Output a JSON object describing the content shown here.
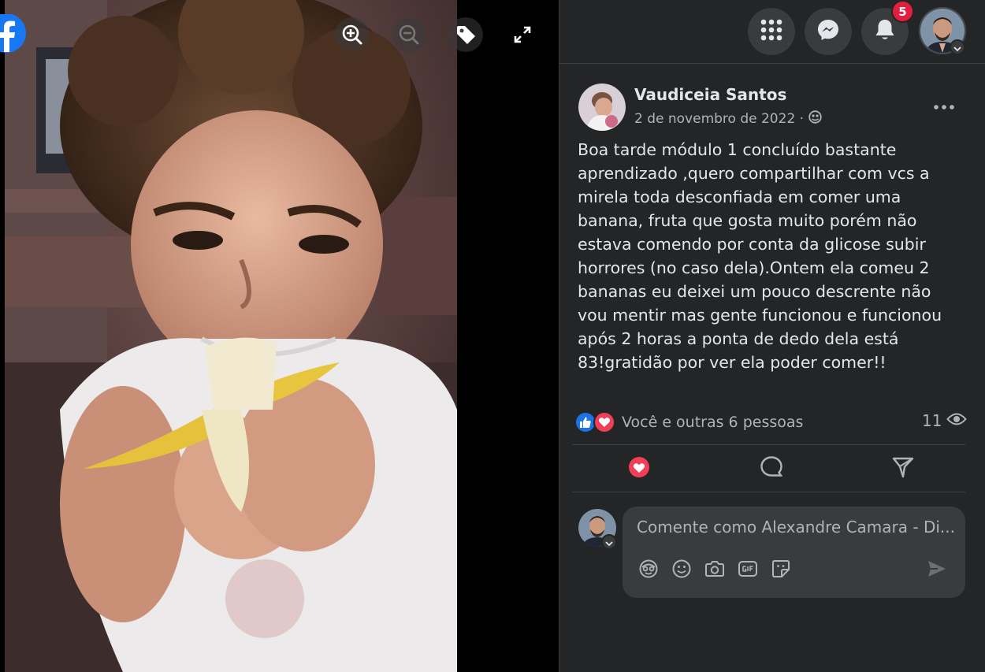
{
  "viewer": {
    "brand_icon": "facebook-logo-icon",
    "controls": [
      {
        "name": "zoom-in-icon"
      },
      {
        "name": "zoom-out-icon"
      },
      {
        "name": "tag-icon"
      },
      {
        "name": "fullscreen-icon"
      }
    ],
    "photo_subject": "photo"
  },
  "topbar": {
    "menu_icon": "grid-menu-icon",
    "messenger_icon": "messenger-icon",
    "notifications_icon": "bell-icon",
    "notifications_count": "5",
    "account_icon": "chevron-down-icon"
  },
  "post": {
    "author": "Vaudiceia Santos",
    "date": "2 de novembro de 2022 ·",
    "audience_icon": "globe-icon",
    "more_icon": "more-dots-icon",
    "text": "Boa tarde módulo 1 concluído bastante aprendizado ,quero compartilhar com vcs a mirela toda desconfiada em comer uma banana, fruta que gosta muito porém não estava comendo por conta da glicose subir horrores (no caso dela).Ontem ela comeu 2 bananas eu deixei um pouco descrente não vou mentir mas gente funcionou e funcionou após 2 horas a ponta de dedo dela está 83!gratidão por ver ela poder comer!!",
    "reactions_text": "Você e outras 6 pessoas",
    "views": "11",
    "actions": [
      {
        "name": "love-reaction-icon"
      },
      {
        "name": "comment-icon"
      },
      {
        "name": "share-icon"
      }
    ]
  },
  "comment": {
    "placeholder": "Comente como Alexandre Camara - Di...",
    "tools": [
      "avatar-sticker-icon",
      "emoji-icon",
      "camera-icon",
      "gif-icon",
      "sticker-icon"
    ],
    "send_icon": "send-icon"
  },
  "colors": {
    "panel_bg": "#242526",
    "surface": "#3a3b3c",
    "text_primary": "#e4e6eb",
    "text_secondary": "#b0b3b8",
    "like_blue": "#1b74e4",
    "love_red": "#f33e58",
    "badge_red": "#e41e3f"
  }
}
